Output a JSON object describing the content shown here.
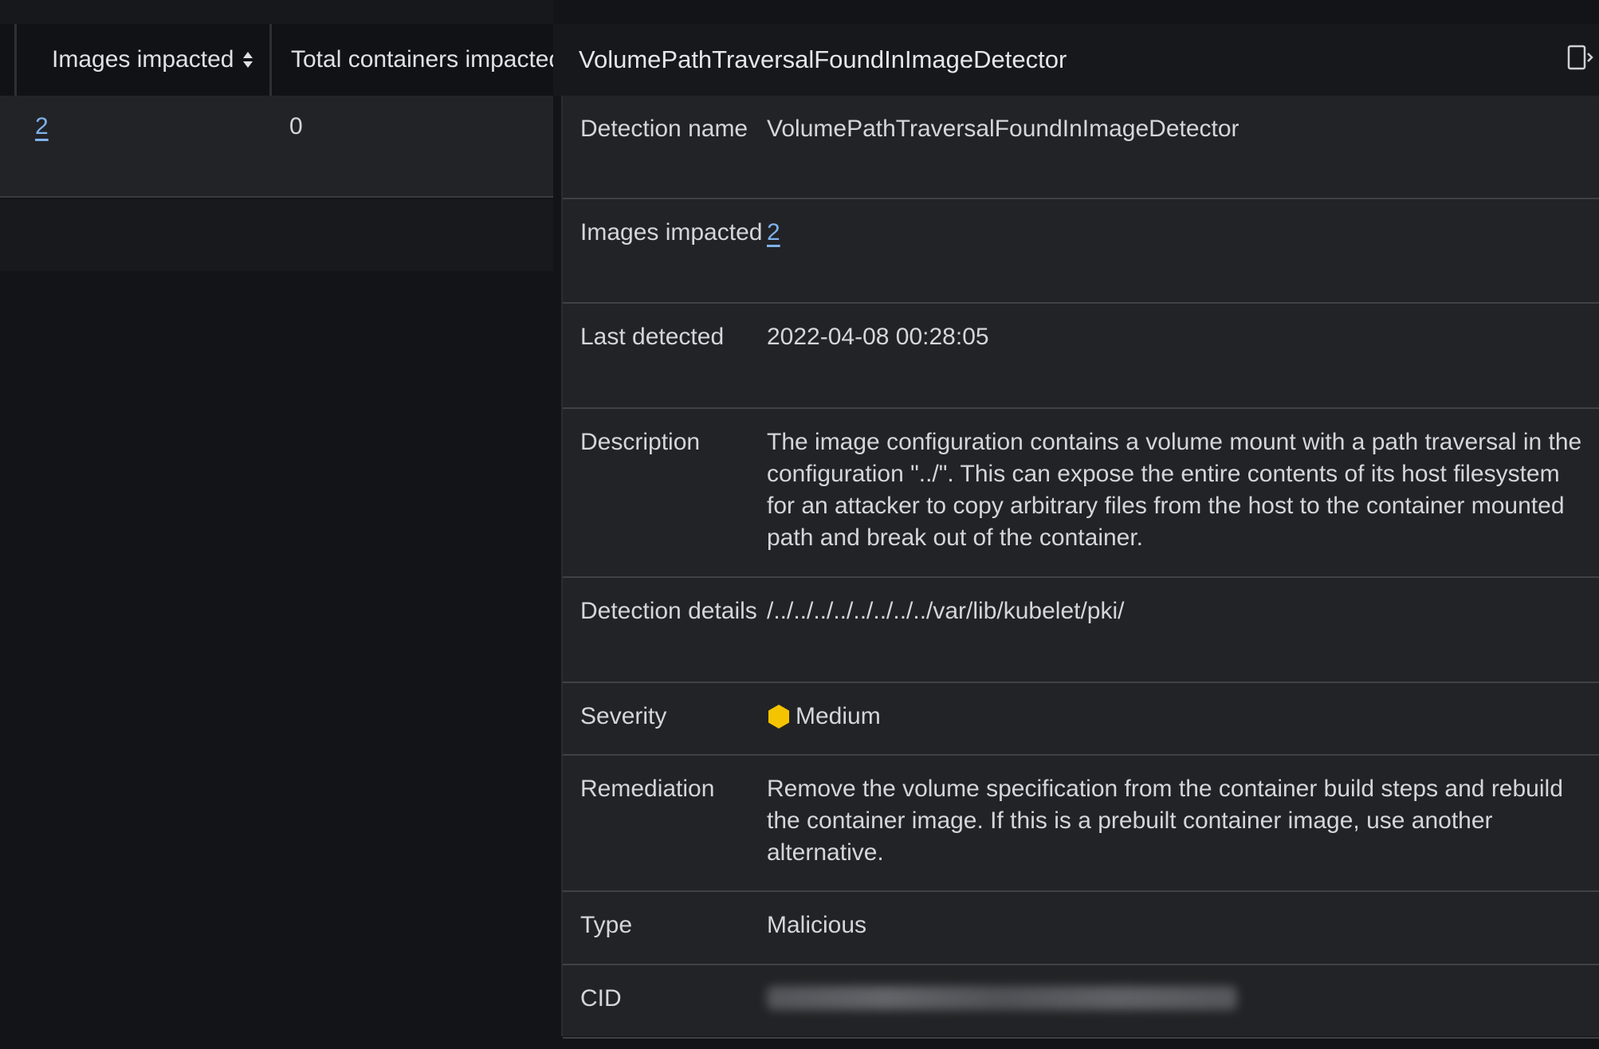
{
  "table": {
    "columns": [
      {
        "label": "Images impacted"
      },
      {
        "label": "Total containers impacted"
      }
    ],
    "rows": [
      {
        "images_impacted": "2",
        "total_containers_impacted": "0"
      }
    ]
  },
  "panel": {
    "title": "VolumePathTraversalFoundInImageDetector",
    "fields": {
      "detection_name": {
        "label": "Detection name",
        "value": "VolumePathTraversalFoundInImageDetector"
      },
      "images_impacted": {
        "label": "Images impacted",
        "value": "2"
      },
      "last_detected": {
        "label": "Last detected",
        "value": "2022-04-08 00:28:05"
      },
      "description": {
        "label": "Description",
        "value": "The image configuration contains a volume mount with a path traversal in the configuration \"../\". This can expose the entire contents of its host filesystem for an attacker to copy arbitrary files from the host to the container mounted path and break out of the container."
      },
      "detection_details": {
        "label": "Detection details",
        "value": "/../../../../../../../../var/lib/kubelet/pki/"
      },
      "severity": {
        "label": "Severity",
        "value": "Medium",
        "color": "#f5c400",
        "icon": "hexagon-icon"
      },
      "remediation": {
        "label": "Remediation",
        "value": "Remove the volume specification from the container build steps and rebuild the container image. If this is a prebuilt container image, use another alternative."
      },
      "type": {
        "label": "Type",
        "value": "Malicious"
      },
      "cid": {
        "label": "CID"
      }
    }
  },
  "colors": {
    "link": "#7fb2ec",
    "background": "#131417",
    "row": "#222326"
  },
  "icons": {
    "sort": "sort-icon",
    "collapse": "collapse-panel-icon"
  }
}
